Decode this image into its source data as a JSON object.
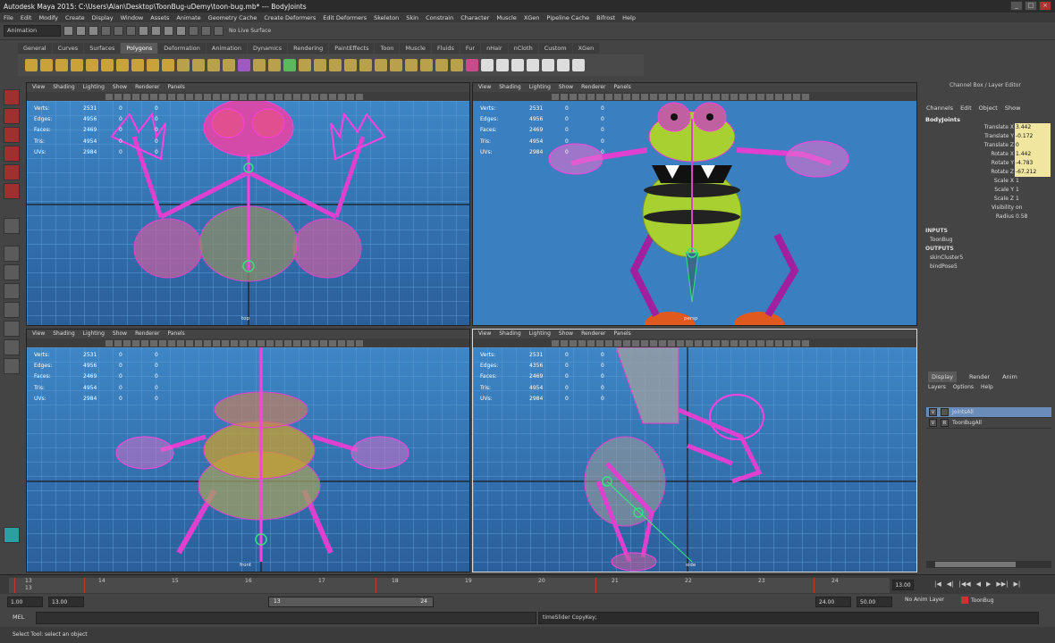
{
  "window": {
    "title": "Autodesk Maya 2015: C:\\Users\\Alan\\Desktop\\ToonBug-uDemy\\toon-bug.mb*  ---  BodyJoints"
  },
  "menus": [
    "File",
    "Edit",
    "Modify",
    "Create",
    "Display",
    "Window",
    "Assets",
    "Animate",
    "Geometry Cache",
    "Create Deformers",
    "Edit Deformers",
    "Skeleton",
    "Skin",
    "Constrain",
    "Character",
    "Muscle",
    "XGen",
    "Pipeline Cache",
    "Bifrost",
    "Help"
  ],
  "status_line": {
    "mode": "Animation",
    "live_surface": "No Live Surface"
  },
  "shelf_tabs": [
    "General",
    "Curves",
    "Surfaces",
    "Polygons",
    "Deformation",
    "Animation",
    "Dynamics",
    "Rendering",
    "PaintEffects",
    "Toon",
    "Muscle",
    "Fluids",
    "Fur",
    "nHair",
    "nCloth",
    "Custom",
    "XGen"
  ],
  "active_shelf_tab": "Polygons",
  "viewport_menu": [
    "View",
    "Shading",
    "Lighting",
    "Show",
    "Renderer",
    "Panels"
  ],
  "hud": {
    "labels": [
      "Verts:",
      "Edges:",
      "Faces:",
      "Tris:",
      "UVs:"
    ],
    "top_left": [
      "2531",
      "4956",
      "2469",
      "4954",
      "2984"
    ],
    "top_right": [
      "2531",
      "4956",
      "2469",
      "4954",
      "2984"
    ],
    "bottom_left": [
      "2531",
      "4956",
      "2469",
      "4954",
      "2984"
    ],
    "bottom_right": [
      "2531",
      "4356",
      "2469",
      "4954",
      "2984"
    ],
    "zero": "0"
  },
  "viewports": {
    "top_left_camera": "top",
    "top_right_camera": "persp",
    "bottom_left_camera": "front",
    "bottom_right_camera": "side"
  },
  "channel_box": {
    "title": "Channel Box / Layer Editor",
    "menu": [
      "Channels",
      "Edit",
      "Object",
      "Show"
    ],
    "object": "BodyJoints",
    "attributes": [
      {
        "name": "Translate X",
        "value": "3.442"
      },
      {
        "name": "Translate Y",
        "value": "-0.172"
      },
      {
        "name": "Translate Z",
        "value": "0"
      },
      {
        "name": "Rotate X",
        "value": "1.442"
      },
      {
        "name": "Rotate Y",
        "value": "-4.783"
      },
      {
        "name": "Rotate Z",
        "value": "-67.212"
      },
      {
        "name": "Scale X",
        "value": "1"
      },
      {
        "name": "Scale Y",
        "value": "1"
      },
      {
        "name": "Scale Z",
        "value": "1"
      },
      {
        "name": "Visibility",
        "value": "on"
      },
      {
        "name": "Radius",
        "value": "0.58"
      }
    ],
    "inputs_label": "INPUTS",
    "inputs": [
      "ToonBug"
    ],
    "outputs_label": "OUTPUTS",
    "outputs": [
      "skinCluster5",
      "bindPose5"
    ]
  },
  "layer_editor": {
    "tabs": [
      "Display",
      "Render",
      "Anim"
    ],
    "menu": [
      "Layers",
      "Options",
      "Help"
    ],
    "layers": [
      {
        "v": "V",
        "r": "",
        "name": "JointsAll"
      },
      {
        "v": "V",
        "r": "R",
        "name": "ToonBugAll"
      }
    ]
  },
  "timeline": {
    "ticks": [
      "13",
      "14",
      "15",
      "16",
      "17",
      "18",
      "19",
      "20",
      "21",
      "22",
      "23",
      "24"
    ],
    "current_frame_marker": "13",
    "current_time": "13.00"
  },
  "range": {
    "start": "1.00",
    "playback_start": "13.00",
    "slider_start": "13",
    "slider_end": "24",
    "playback_end": "24.00",
    "end": "50.00",
    "anim_layer": "No Anim Layer",
    "character": "ToonBug"
  },
  "command_line": {
    "label": "MEL",
    "result": "timeSlider CopyKey;"
  },
  "help_line": "Select Tool: select an object"
}
